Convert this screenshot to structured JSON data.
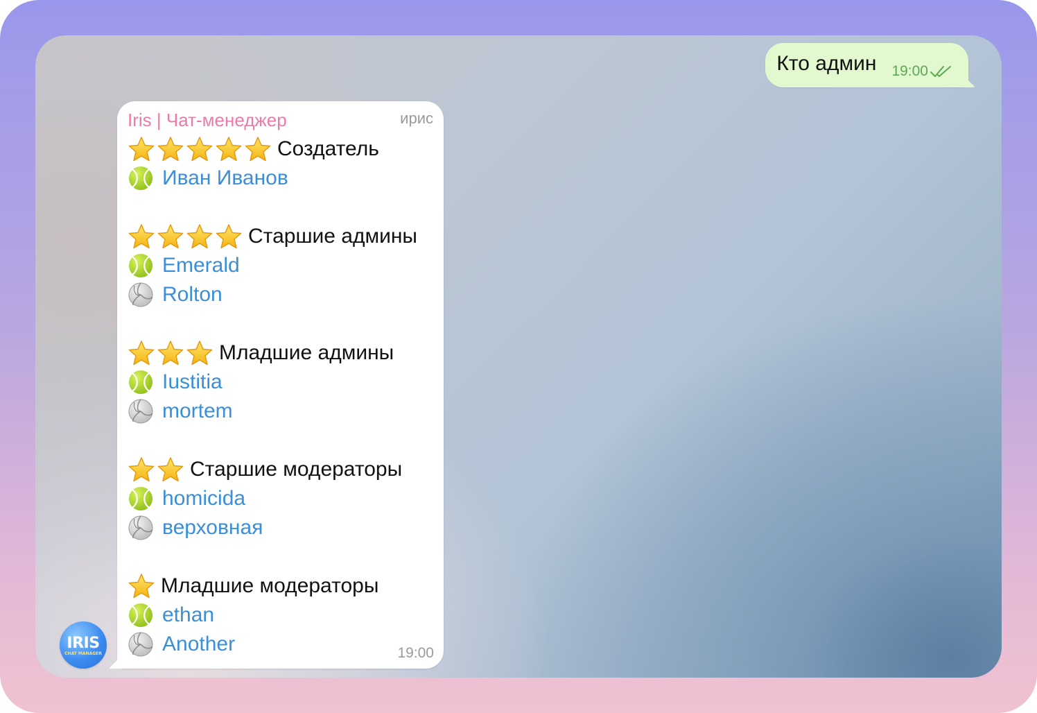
{
  "outgoing": {
    "text": "Кто админ",
    "time": "19:00",
    "status_icon": "double-check-icon",
    "bubble_color": "#e2f9cf"
  },
  "incoming": {
    "sender": "Iris | Чат-менеджер",
    "sender_color": "#ef7aa9",
    "tag": "ирис",
    "time": "19:00",
    "link_color": "#3b8ed8",
    "groups": [
      {
        "stars": 5,
        "role": "Создатель",
        "members": [
          {
            "name": "Иван Иванов",
            "icon": "tennis-ball-icon"
          }
        ]
      },
      {
        "stars": 4,
        "role": "Старшие админы",
        "members": [
          {
            "name": "Emerald",
            "icon": "tennis-ball-icon"
          },
          {
            "name": "Rolton",
            "icon": "volleyball-icon"
          }
        ]
      },
      {
        "stars": 3,
        "role": "Младшие админы",
        "members": [
          {
            "name": "Iustitia",
            "icon": "tennis-ball-icon"
          },
          {
            "name": "mortem",
            "icon": "volleyball-icon"
          }
        ]
      },
      {
        "stars": 2,
        "role": "Старшие модераторы",
        "members": [
          {
            "name": "homicida",
            "icon": "tennis-ball-icon"
          },
          {
            "name": "верховная",
            "icon": "volleyball-icon"
          }
        ]
      },
      {
        "stars": 1,
        "role": "Младшие модераторы",
        "members": [
          {
            "name": "ethan",
            "icon": "tennis-ball-icon"
          },
          {
            "name": "Another",
            "icon": "volleyball-icon"
          }
        ]
      }
    ]
  },
  "avatar": {
    "main": "IRIS",
    "sub": "CHAT MANAGER"
  }
}
